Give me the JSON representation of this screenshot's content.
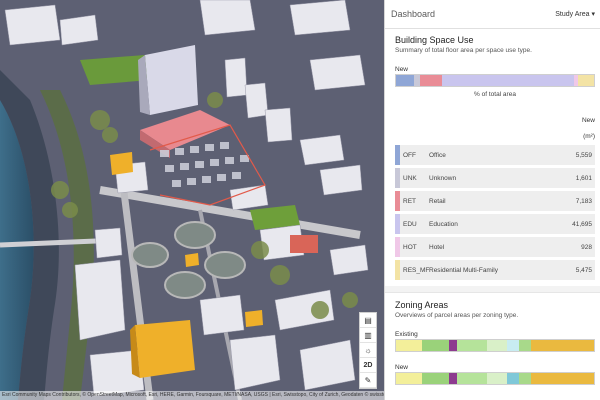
{
  "header": {
    "title": "Dashboard",
    "study_area_label": "Study Area"
  },
  "colors": {
    "office": "#8fa6d6",
    "unknown": "#c8c8d8",
    "retail": "#e98c96",
    "education": "#c9c5ee",
    "hotel": "#f0c8e8",
    "residential_multifamily": "#f3e3a5",
    "panel_bg": "#f3f3f3"
  },
  "building_space_use": {
    "title": "Building Space Use",
    "description": "Summary of total floor area per space use type.",
    "bar_label": "New",
    "axis_label": "% of total area",
    "column_header": "New",
    "column_unit": "(m²)",
    "rows": [
      {
        "code": "OFF",
        "name": "Office",
        "value": "5,559",
        "color": "#8fa6d6"
      },
      {
        "code": "UNK",
        "name": "Unknown",
        "value": "1,601",
        "color": "#c8c8d8"
      },
      {
        "code": "RET",
        "name": "Retail",
        "value": "7,183",
        "color": "#e98c96"
      },
      {
        "code": "EDU",
        "name": "Education",
        "value": "41,695",
        "color": "#c9c5ee"
      },
      {
        "code": "HOT",
        "name": "Hotel",
        "value": "928",
        "color": "#f0c8e8"
      },
      {
        "code": "RES_MF",
        "name": "Residential Multi-Family",
        "value": "5,475",
        "color": "#f3e3a5"
      }
    ]
  },
  "zoning_areas": {
    "title": "Zoning Areas",
    "description": "Overviews of parcel areas per zoning type.",
    "existing_label": "Existing",
    "new_label": "New"
  },
  "map": {
    "tools": [
      "layers-icon",
      "measure-icon",
      "daylight-icon",
      "2D",
      "edit-icon"
    ],
    "attribution": "Esri Community Maps Contributors, © OpenStreetMap, Microsoft, Esri, HERE, Garmin, Foursquare, METI/NASA, USGS | Esri, Swisstopo, City of Zurich, Geodaten © swisstopo, Switzerland"
  }
}
